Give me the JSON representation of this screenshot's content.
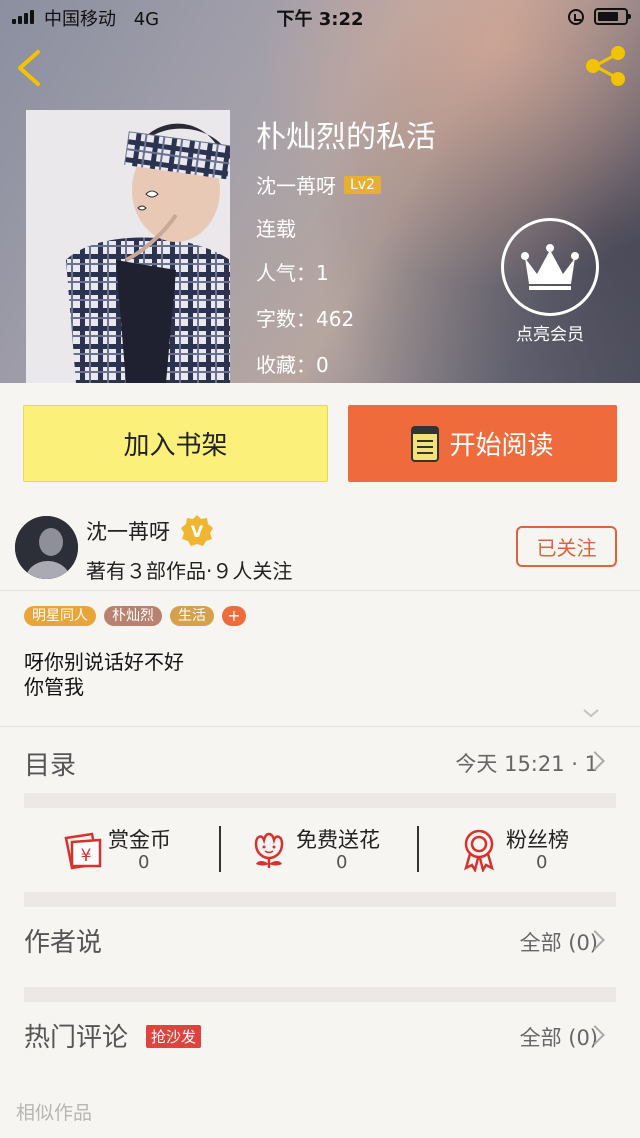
{
  "status_bar": {
    "carrier": "中国移动",
    "network": "4G",
    "time": "下午 3:22"
  },
  "book": {
    "title": "朴灿烈的私活",
    "author": "沈一苒呀",
    "level": "Lv2",
    "status": "连载",
    "popularity": "人气：1",
    "word_count": "字数：462",
    "favorites": "收藏：0"
  },
  "vip": {
    "label": "点亮会员"
  },
  "actions": {
    "add_shelf": "加入书架",
    "start_reading": "开始阅读"
  },
  "author_card": {
    "name": "沈一苒呀",
    "stats": "著有３部作品·９人关注",
    "follow": "已关注",
    "verified_badge": "V"
  },
  "tags": [
    {
      "label": "明星同人",
      "color": "#e9a43a"
    },
    {
      "label": "朴灿烈",
      "color": "#b98170"
    },
    {
      "label": "生活",
      "color": "#d4a24a"
    }
  ],
  "tag_add": "+",
  "intro": {
    "line1": "呀你别说话好不好",
    "line2": "你管我"
  },
  "catalog": {
    "title": "目录",
    "update": "今天 15:21 · 1"
  },
  "support": [
    {
      "label": "赏金币",
      "value": "0",
      "icon": "red-envelope-icon"
    },
    {
      "label": "免费送花",
      "value": "0",
      "icon": "flower-icon"
    },
    {
      "label": "粉丝榜",
      "value": "0",
      "icon": "medal-icon"
    }
  ],
  "author_says": {
    "title": "作者说",
    "all": "全部 (0)"
  },
  "hot_comments": {
    "title": "热门评论",
    "badge": "抢沙发",
    "all": "全部 (0)"
  },
  "similar": {
    "title": "相似作品"
  },
  "colors": {
    "accent_orange": "#ef6b3c",
    "shelf_yellow": "#fbf17a",
    "icon_red": "#d8322e",
    "level_gold": "#e7b033"
  }
}
